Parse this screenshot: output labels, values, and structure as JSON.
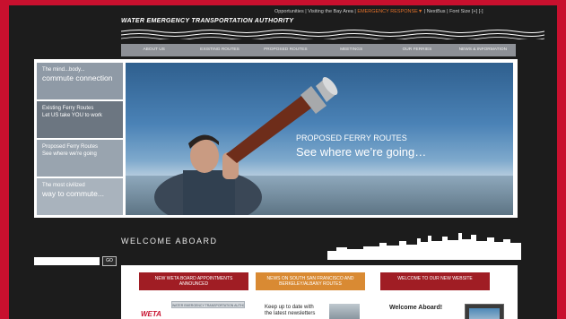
{
  "colors": {
    "brand_red": "#c8102e",
    "nav_gray": "#8d9096",
    "panel_dark": "#1c1c1c",
    "accent_orange": "#e0702a"
  },
  "header": {
    "utility_links": [
      "Opportunities",
      "Visiting the Bay Area",
      "EMERGENCY RESPONSE▼",
      "NextBus",
      "Font Size [+] [-]"
    ],
    "org_name": "WATER EMERGENCY TRANSPORTATION AUTHORITY"
  },
  "nav": {
    "items": [
      "ABOUT US",
      "EXISTING ROUTES",
      "PROPOSED ROUTES",
      "MEETINGS",
      "OUR FERRIES",
      "NEWS & INFORMATION"
    ]
  },
  "hero": {
    "tabs": [
      {
        "line1": "The mind...body...",
        "line2": "commute connection"
      },
      {
        "line1": "Existing Ferry Routes",
        "line2": "Let US take YOU to work"
      },
      {
        "line1": "Proposed Ferry Routes",
        "line2": "See where we're going"
      },
      {
        "line1": "The most civilized",
        "line2": "way to commute..."
      }
    ],
    "title": "PROPOSED FERRY ROUTES",
    "subtitle": "See where we’re going…"
  },
  "welcome": {
    "title": "WELCOME ABOARD"
  },
  "search": {
    "value": "",
    "go_label": "GO"
  },
  "content": {
    "banners": [
      "NEW WETA BOARD APPOINTMENTS ANNOUNCED",
      "NEWS ON SOUTH SAN FRANCISCO AND BERKELEY/ALBANY ROUTES",
      "WELCOME TO OUR NEW WEBSITE"
    ],
    "weta_logo": "WETA",
    "weta_small": "WATER EMERGENCY TRANSPORTATION AUTHORITY",
    "keep_up": "Keep up to date with\nthe latest newsletters",
    "welcome_aboard": "Welcome Aboard!"
  }
}
